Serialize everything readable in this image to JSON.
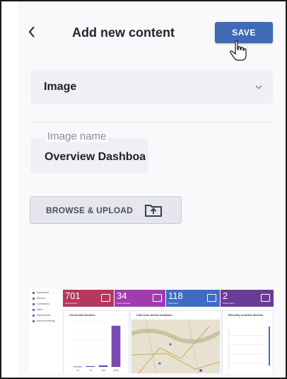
{
  "header": {
    "back_icon": "chevron-left-icon",
    "title": "Add new content",
    "save_label": "SAVE"
  },
  "content_type": {
    "selected": "Image",
    "icon": "chevron-down-icon"
  },
  "image_name": {
    "label": "Image name",
    "value": "Overview Dashboard"
  },
  "upload": {
    "label": "BROWSE & UPLOAD",
    "icon": "folder-upload-icon"
  },
  "preview": {
    "sidebar": [
      "Dashboard",
      "Devices",
      "Commands",
      "Users",
      "Repositories",
      "Account settings"
    ],
    "kpis": [
      {
        "value": "701",
        "label": "Total devices",
        "color": "#b5385d"
      },
      {
        "value": "34",
        "label": "Active devices",
        "color": "#a23bb0"
      },
      {
        "value": "118",
        "label": "Total users",
        "color": "#3f6bc4"
      },
      {
        "value": "2",
        "label": "Active users",
        "color": "#6a3c96"
      }
    ],
    "cards": {
      "connected": "Connected devices",
      "map": "Last seen device locations",
      "recent": "Recently enrolled devices"
    }
  },
  "chart_data": {
    "type": "bar",
    "categories": [
      "1d",
      "7d",
      "30d",
      "100d"
    ],
    "values": [
      1,
      2,
      4,
      100
    ],
    "title": "Connected devices",
    "ylim": [
      0,
      110
    ]
  }
}
